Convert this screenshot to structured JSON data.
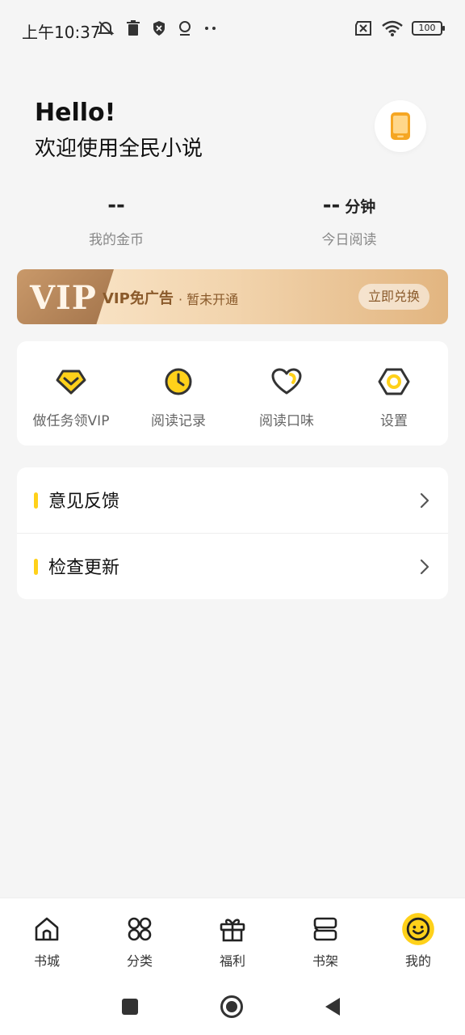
{
  "status_bar": {
    "time": "上午10:37",
    "battery": "100"
  },
  "header": {
    "greeting": "Hello!",
    "welcome": "欢迎使用全民小说"
  },
  "stats": {
    "coins_value": "--",
    "coins_label": "我的金币",
    "read_value": "--",
    "read_unit": "分钟",
    "read_label": "今日阅读"
  },
  "vip_banner": {
    "logo": "VIP",
    "title": "VIP免广告",
    "status": "· 暂未开通",
    "redeem_label": "立即兑换"
  },
  "features": [
    {
      "label": "做任务领VIP",
      "icon": "vip-diamond-icon"
    },
    {
      "label": "阅读记录",
      "icon": "clock-icon"
    },
    {
      "label": "阅读口味",
      "icon": "heart-icon"
    },
    {
      "label": "设置",
      "icon": "hexagon-settings-icon"
    }
  ],
  "list": [
    {
      "label": "意见反馈"
    },
    {
      "label": "检查更新"
    }
  ],
  "bottom_nav": [
    {
      "label": "书城",
      "icon": "home-icon"
    },
    {
      "label": "分类",
      "icon": "category-icon"
    },
    {
      "label": "福利",
      "icon": "gift-icon"
    },
    {
      "label": "书架",
      "icon": "bookshelf-icon"
    },
    {
      "label": "我的",
      "icon": "smiley-icon"
    }
  ],
  "colors": {
    "accent": "#ffd11a",
    "vip_text": "#8a5a2b",
    "icon_orange": "#f5a623"
  }
}
